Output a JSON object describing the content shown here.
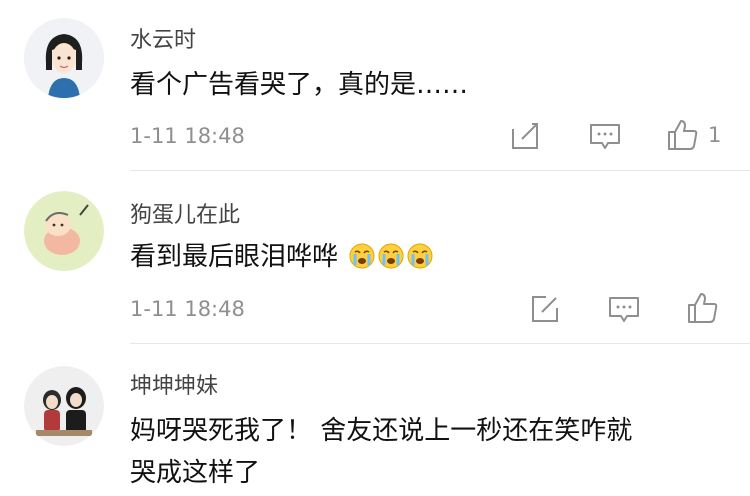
{
  "comments": [
    {
      "username": "水云时",
      "text": "看个广告看哭了，真的是……",
      "time": "1-11 18:48",
      "likes": "1",
      "avatar": "girl-avatar"
    },
    {
      "username": "狗蛋儿在此",
      "text": "看到最后眼泪哗哗",
      "emoji": [
        "crying-emoji",
        "crying-emoji",
        "crying-emoji"
      ],
      "time": "1-11 18:48",
      "avatar": "dog-avatar"
    },
    {
      "username": "坤坤坤妹",
      "text_line1": "妈呀哭死我了！ 舍友还说上一秒还在笑咋就",
      "text_line2": "哭成这样了",
      "avatar": "couple-avatar"
    }
  ],
  "colors": {
    "meta": "#8f8f8f",
    "text": "#111111",
    "divider": "#e6e6e6"
  },
  "icons": [
    "edit-icon",
    "comment-icon",
    "thumbs-up-icon"
  ]
}
